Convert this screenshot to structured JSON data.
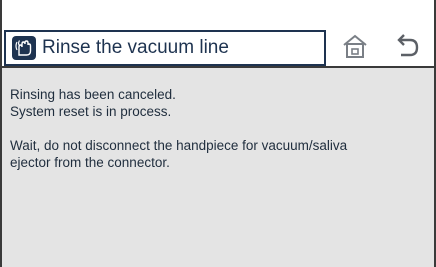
{
  "header": {
    "title": "Rinse the vacuum line",
    "title_icon": "vacuum-handpiece-icon",
    "home_icon": "home-icon",
    "back_icon": "back-icon"
  },
  "message": {
    "line1": "Rinsing has been canceled.",
    "line2": "System reset is in process.",
    "line3": "Wait, do not disconnect the handpiece for vacuum/saliva",
    "line4": "ejector from the connector."
  },
  "colors": {
    "accent": "#1e3350",
    "background": "#e4e4e4",
    "icon_gray": "#7a7f86"
  }
}
